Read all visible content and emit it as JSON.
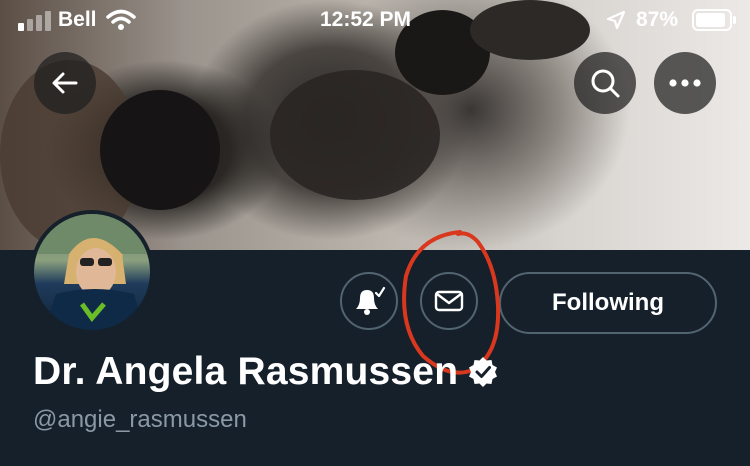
{
  "status_bar": {
    "carrier": "Bell",
    "time": "12:52 PM",
    "battery_percent": "87%",
    "signal_bars_filled": 1,
    "signal_bars_total": 4
  },
  "header": {
    "back_icon": "arrow-left-icon",
    "search_icon": "search-icon",
    "more_icon": "more-horizontal-icon"
  },
  "profile": {
    "display_name": "Dr. Angela Rasmussen",
    "handle": "@angie_rasmussen",
    "verified": true,
    "follow_button_label": "Following",
    "notifications_icon": "bell-check-icon",
    "message_icon": "envelope-icon"
  },
  "annotation": {
    "color": "#d9381e",
    "target": "message-button"
  },
  "colors": {
    "background": "#15202b",
    "border": "#536471",
    "secondary_text": "#8b98a5"
  }
}
